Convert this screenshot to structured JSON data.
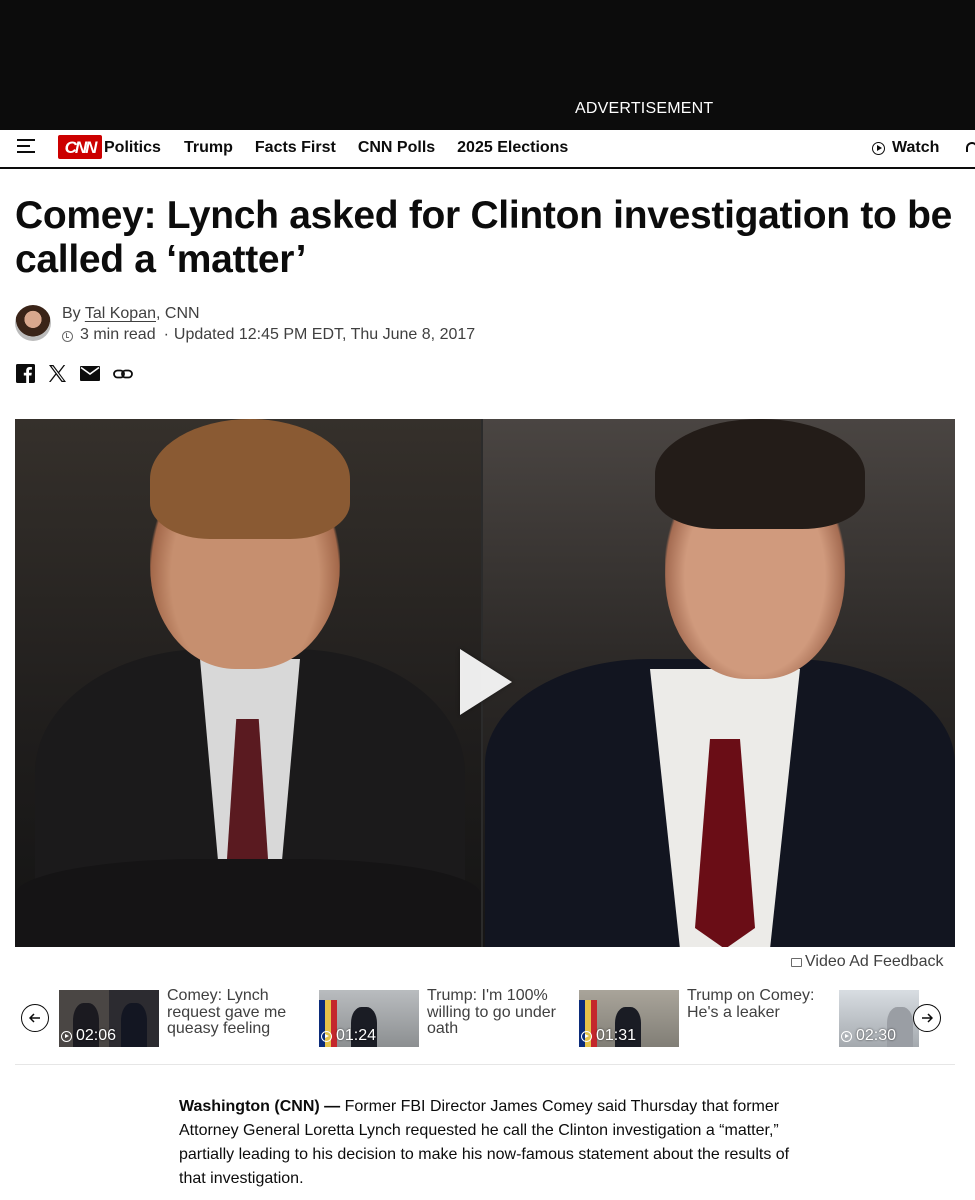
{
  "ad": {
    "label": "ADVERTISEMENT"
  },
  "nav": {
    "logo_text": "CNN",
    "section": "Politics",
    "links": [
      "Trump",
      "Facts First",
      "CNN Polls",
      "2025 Elections"
    ],
    "watch_label": "Watch"
  },
  "article": {
    "headline": "Comey: Lynch asked for Clinton investigation to be called a ‘matter’",
    "byline_prefix": "By",
    "author": "Tal Kopan",
    "source": ", CNN",
    "read_time": "3 min read",
    "updated": "Updated 12:45 PM EDT, Thu June 8, 2017",
    "dateline": "Washington (CNN) —",
    "lede": "Former FBI Director James Comey said Thursday that former Attorney General Loretta Lynch requested he call the Clinton investigation a “matter,” partially leading to his decision to make his now-famous statement about the results of that investigation."
  },
  "share": {
    "icons": [
      "facebook-icon",
      "x-icon",
      "email-icon",
      "link-icon"
    ]
  },
  "video": {
    "ad_feedback": "Video Ad Feedback"
  },
  "carousel": {
    "items": [
      {
        "duration": "02:06",
        "title": "Comey: Lynch request gave me queasy feeling"
      },
      {
        "duration": "01:24",
        "title": "Trump: I'm 100% willing to go under oath"
      },
      {
        "duration": "01:31",
        "title": "Trump on Comey: He's a leaker"
      },
      {
        "duration": "02:30",
        "title": ""
      }
    ]
  },
  "colors": {
    "brand_red": "#cc0000",
    "ad_background": "#0c0c0c",
    "text": "#0c0c0c",
    "muted_text": "#404040"
  }
}
